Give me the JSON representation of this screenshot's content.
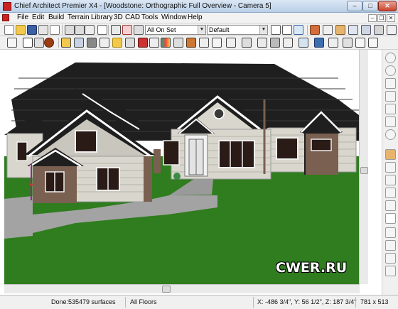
{
  "window": {
    "title": "Chief Architect Premier X4 - [Woodstone: Orthographic Full Overview - Camera 5]",
    "min_glyph": "–",
    "max_glyph": "□",
    "close_glyph": "✕"
  },
  "menu": {
    "items": [
      "File",
      "Edit",
      "Build",
      "Terrain",
      "Library",
      "3D",
      "CAD",
      "Tools",
      "Window",
      "Help"
    ],
    "mdi_min": "–",
    "mdi_restore": "❐",
    "mdi_close": "✕"
  },
  "toolbar": {
    "layer_set": "All On Set",
    "layer_style": "Default",
    "dropdown_arrow": "▼"
  },
  "status": {
    "mode": "Done:",
    "surfaces": "535479 surfaces",
    "floor": "All Floors",
    "coords": "X: -486 3/4\", Y: 56 1/2\", Z: 187 3/4\"",
    "size": "781 x 513"
  },
  "watermark": "CWER.RU",
  "colors": {
    "roof": "#1f1f1f",
    "siding": "#d9d7cd",
    "lawn": "#2f7d1e",
    "path": "#a3a3a3",
    "stone": "#7a6050",
    "sky": "#ffffff",
    "trim": "#f5f5f5"
  }
}
